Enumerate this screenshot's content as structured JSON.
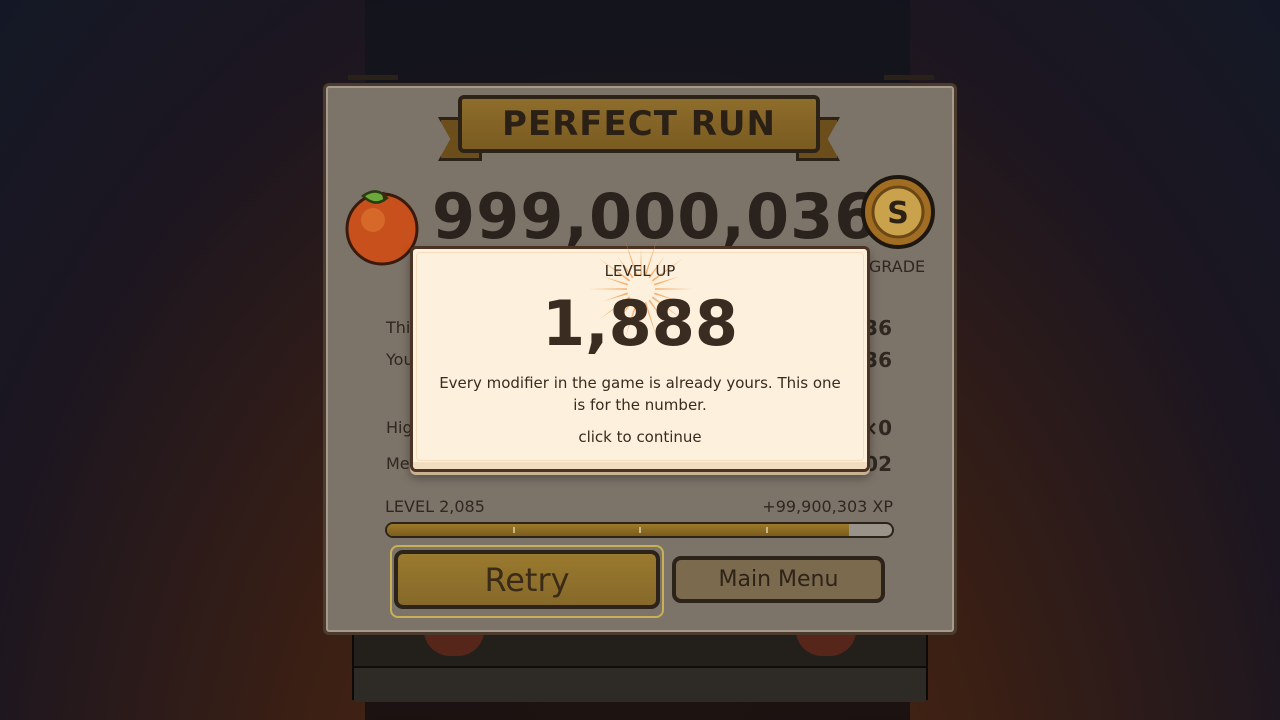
{
  "results": {
    "banner_title": "PERFECT RUN",
    "score": "999,000,036",
    "grade_letter": "S",
    "grade_label": "GRADE",
    "fruit_icon": "orange-icon",
    "stats": [
      {
        "label": "Thi",
        "value": "36"
      },
      {
        "label": "You",
        "value": "36"
      },
      {
        "label": "Hig",
        "value": "×0"
      },
      {
        "label": "Mer",
        "value": "02"
      }
    ],
    "xp": {
      "level_label": "LEVEL 2,085",
      "gain_label": "+99,900,303 XP",
      "progress": 0.915
    },
    "retry_label": "Retry",
    "menu_label": "Main Menu"
  },
  "level_up": {
    "label": "LEVEL UP",
    "level": "1,888",
    "message": "Every modifier in the game is already yours. This one is for the number.",
    "continue_text": "click to continue"
  },
  "colors": {
    "gold": "#8e6d2c",
    "modal_bg": "#fdf0dc",
    "text_dark": "#2f2720",
    "burst": "#f29a4a"
  }
}
